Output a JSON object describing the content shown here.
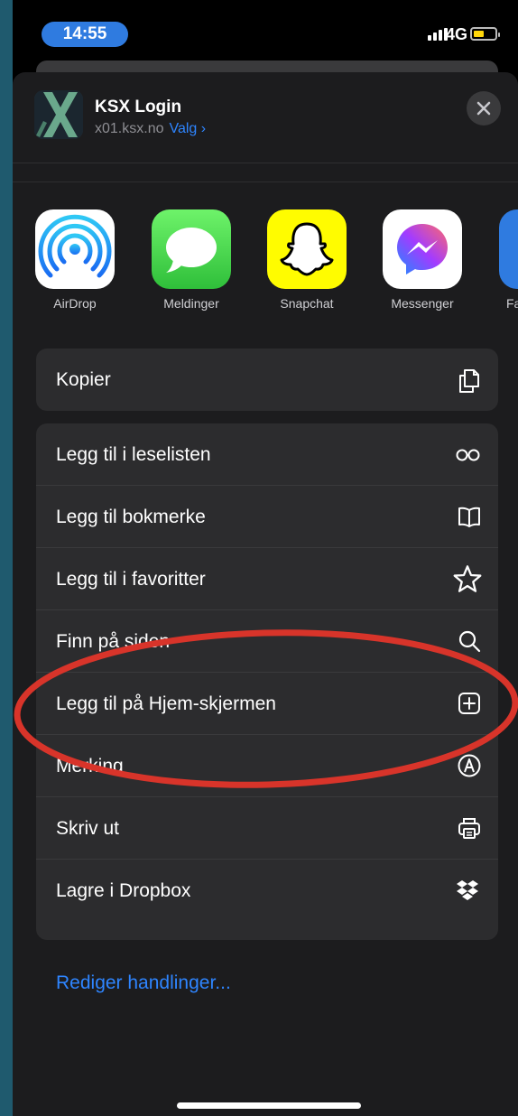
{
  "status": {
    "time": "14:55",
    "network": "4G"
  },
  "header": {
    "title": "KSX Login",
    "url": "x01.ksx.no",
    "options_label": "Valg ›"
  },
  "share_apps": [
    {
      "label": "AirDrop",
      "icon": "airdrop-icon"
    },
    {
      "label": "Meldinger",
      "icon": "messages-icon"
    },
    {
      "label": "Snapchat",
      "icon": "snapchat-icon"
    },
    {
      "label": "Messenger",
      "icon": "messenger-icon"
    },
    {
      "label": "Fa",
      "icon": "facebook-icon"
    }
  ],
  "actions": {
    "copy": {
      "label": "Kopier",
      "icon": "copy-icon"
    },
    "reading_list": {
      "label": "Legg til i leselisten",
      "icon": "glasses-icon"
    },
    "bookmark": {
      "label": "Legg til bokmerke",
      "icon": "book-icon"
    },
    "favorites": {
      "label": "Legg til i favoritter",
      "icon": "star-icon"
    },
    "find": {
      "label": "Finn på siden",
      "icon": "search-icon"
    },
    "home_screen": {
      "label": "Legg til på Hjem-skjermen",
      "icon": "plus-square-icon"
    },
    "markup": {
      "label": "Merking",
      "icon": "markup-icon"
    },
    "print": {
      "label": "Skriv ut",
      "icon": "printer-icon"
    },
    "dropbox": {
      "label": "Lagre i Dropbox",
      "icon": "dropbox-icon"
    }
  },
  "edit_actions_label": "Rediger handlinger...",
  "colors": {
    "accent": "#2e85ff",
    "annotation": "#d8342a",
    "sheet": "#1c1c1e",
    "cell": "#2c2c2e"
  }
}
